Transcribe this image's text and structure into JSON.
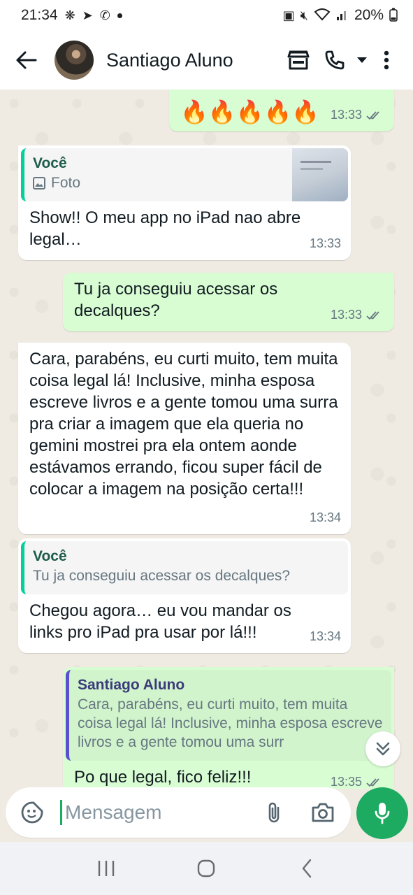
{
  "status_bar": {
    "time": "21:34",
    "battery": "20%",
    "icons_left": [
      "pinwheel-icon",
      "telegram-icon",
      "whatsapp-icon",
      "dot"
    ],
    "icons_right": [
      "battery-saver-icon",
      "mute-icon",
      "wifi-icon",
      "signal-icon",
      "battery-icon"
    ]
  },
  "header": {
    "contact_name": "Santiago Aluno",
    "actions": [
      "store-icon",
      "call-icon",
      "dropdown-icon",
      "more-icon"
    ]
  },
  "messages": [
    {
      "direction": "out",
      "text": "🔥🔥🔥🔥🔥",
      "time": "13:33",
      "status": "read"
    },
    {
      "direction": "in",
      "quote": {
        "author": "Você",
        "text": "Foto",
        "type": "photo"
      },
      "text": "Show!! O meu app no iPad nao abre legal…",
      "time": "13:33"
    },
    {
      "direction": "out",
      "text": "Tu ja conseguiu acessar os decalques?",
      "time": "13:33",
      "status": "read"
    },
    {
      "direction": "in",
      "text": "Cara, parabéns, eu curti muito, tem muita coisa legal lá!  Inclusive, minha esposa escreve livros e a gente tomou uma surra pra criar a imagem que ela queria no gemini mostrei pra ela ontem aonde estávamos errando, ficou super fácil de colocar a imagem na posição certa!!!",
      "time": "13:34"
    },
    {
      "direction": "in",
      "quote": {
        "author": "Você",
        "text": "Tu ja conseguiu acessar os decalques?"
      },
      "text": "Chegou agora… eu vou mandar os links pro iPad pra usar por lá!!!",
      "time": "13:34"
    },
    {
      "direction": "out",
      "quote": {
        "author": "Santiago Aluno",
        "text": "Cara, parabéns, eu curti muito, tem muita coisa legal lá!  Inclusive, minha esposa escreve livros e a gente tomou uma surr"
      },
      "text": "Po que legal, fico feliz!!!",
      "time": "13:35",
      "status": "read"
    }
  ],
  "input": {
    "placeholder": "Mensagem",
    "value": ""
  },
  "colors": {
    "accent": "#1daa61",
    "outgoing_bubble": "#d9fdd3",
    "incoming_bubble": "#ffffff",
    "chat_background": "#efeae2",
    "read_ticks": "#53bdeb"
  }
}
